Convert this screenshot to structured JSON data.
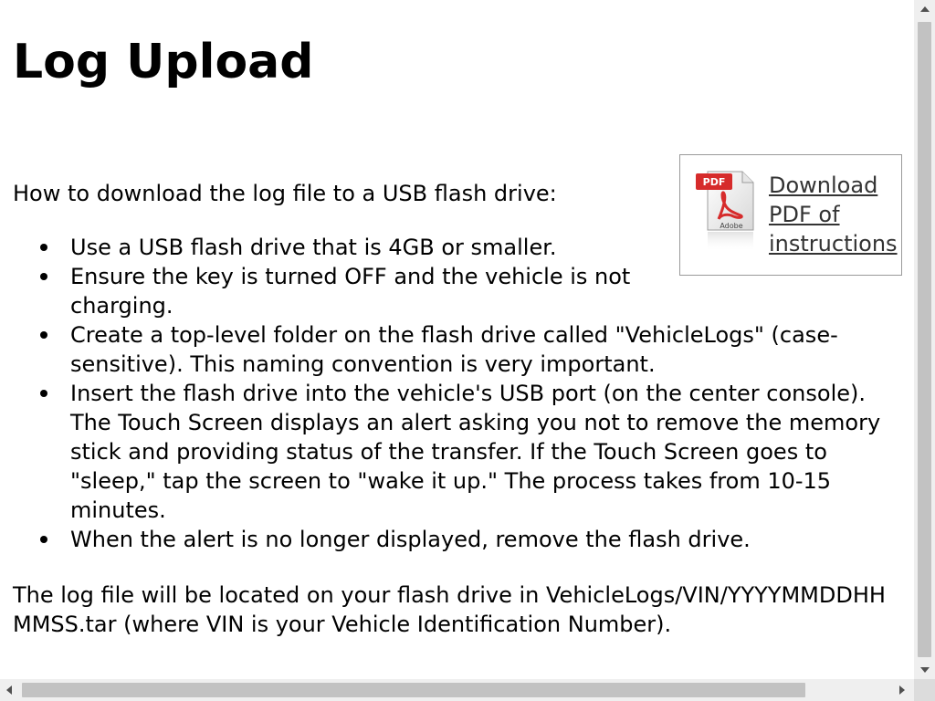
{
  "page": {
    "title": "Log Upload",
    "pdf": {
      "icon": "pdf-document-icon",
      "link_label": "Download PDF of instructions",
      "icon_badge": "PDF",
      "icon_brand": "Adobe"
    },
    "intro": "How to download the log file to a USB flash drive:",
    "steps": [
      "Use a USB flash drive that is 4GB or smaller.",
      "Ensure the key is turned OFF and the vehicle is not charging.",
      "Create a top-level folder on the flash drive called \"VehicleLogs\" (case-sensitive). This naming convention is very important.",
      "Insert the flash drive into the vehicle's USB port (on the center console). The Touch Screen displays an alert asking you not to remove the memory stick and providing status of the transfer. If the Touch Screen goes to \"sleep,\" tap the screen to \"wake it up.\" The process takes from 10-15 minutes.",
      "When the alert is no longer displayed, remove the flash drive."
    ],
    "footer": "The log file will be located on your flash drive in VehicleLogs/VIN/YYYYMMDDHHMMSS.tar (where VIN is your Vehicle Identification Number)."
  },
  "colors": {
    "background": "#ffffff",
    "text": "#000000",
    "link": "#333333",
    "pdf_red": "#d62b2b",
    "scrollbar_track": "#efefef",
    "scrollbar_thumb": "#c2c2c2"
  }
}
